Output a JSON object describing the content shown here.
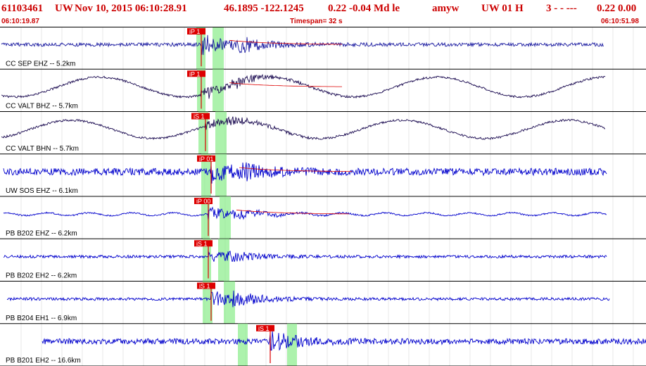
{
  "header": {
    "event_id": "61103461",
    "network": "UW",
    "datetime": "Nov 10, 2015 06:10:28.91",
    "latlon": "46.1895 -122.1245",
    "magnitude": "0.22 -0.04 Md le",
    "author": "amyw",
    "source": "UW 01 H",
    "extra": "3 - - ---",
    "trailing": "0.22 0.00"
  },
  "subheader": {
    "start_time": "06:10:19.87",
    "timespan": "Timespan= 32 s",
    "end_time": "06:10:51.98"
  },
  "colors": {
    "header_text": "#cc0000",
    "trace_blue": "#0000cc",
    "trace_dark": "#1a0a50",
    "pick_red": "#dd0000",
    "highlight_green": "#90ee90"
  },
  "traces": [
    {
      "label": "CC SEP EHZ -- 5.2km",
      "color": "dark_blue",
      "pick": "iP 1",
      "s_pick": "",
      "onset_time": "06:10:29.9"
    },
    {
      "label": "CC VALT BHZ -- 5.7km",
      "color": "dark",
      "pick": "iP 1",
      "s_pick": "",
      "onset_time": "06:10:29.9"
    },
    {
      "label": "CC VALT BHN -- 5.7km",
      "color": "dark",
      "pick": "iS 1",
      "s_pick": "iS 1",
      "onset_time": "06:10:30.7"
    },
    {
      "label": "UW SOS EHZ -- 6.1km",
      "color": "blue",
      "pick": "iP 01",
      "s_pick": "",
      "onset_time": "06:10:30.1"
    },
    {
      "label": "PB B202 EHZ -- 6.2km",
      "color": "blue",
      "pick": "iP 00",
      "s_pick": "",
      "onset_time": "06:10:30.2"
    },
    {
      "label": "PB B202 EH2 -- 6.2km",
      "color": "blue",
      "pick": "iS 1",
      "s_pick": "iS 1",
      "onset_time": "06:10:31.2"
    },
    {
      "label": "PB B204 EH1 -- 6.9km",
      "color": "blue",
      "pick": "iS 1",
      "s_pick": "iS 1",
      "onset_time": "06:10:31.7"
    },
    {
      "label": "PB B201 EH2 -- 16.6km",
      "color": "blue",
      "pick": "iS 1",
      "s_pick": "iS 1",
      "onset_time": "06:10:33.7"
    }
  ]
}
